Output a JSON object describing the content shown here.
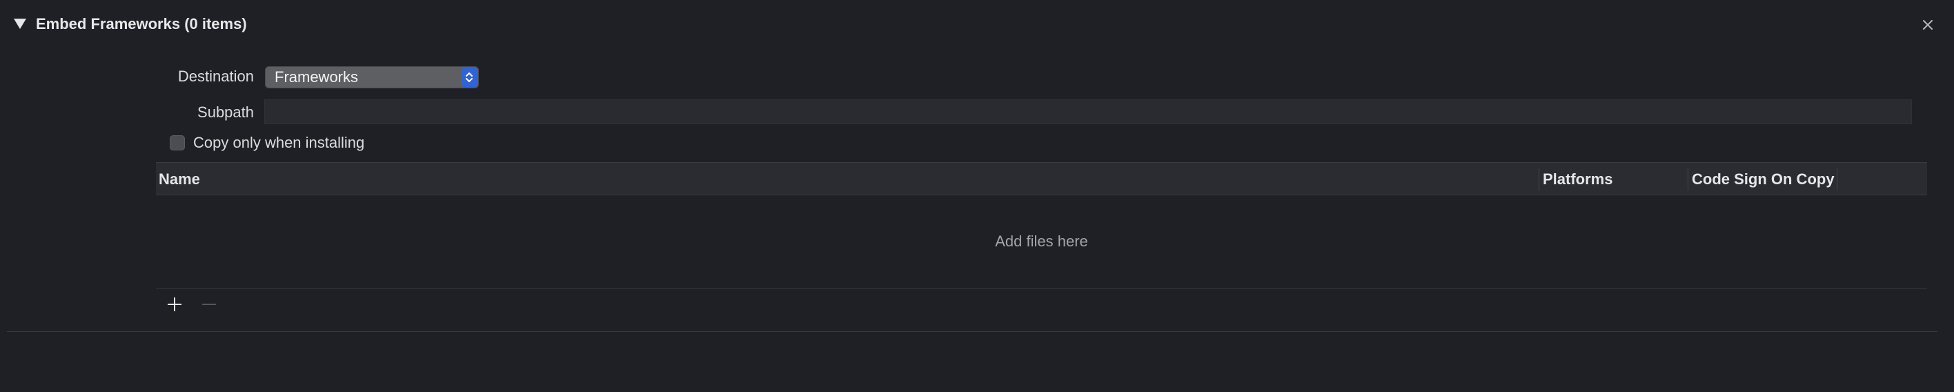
{
  "header": {
    "title": "Embed Frameworks (0 items)",
    "disclosure_icon": "disclosure-triangle-down-icon",
    "close_icon": "close-icon"
  },
  "form": {
    "destination_label": "Destination",
    "destination_value": "Frameworks",
    "subpath_label": "Subpath",
    "subpath_value": "",
    "copy_only_label": "Copy only when installing",
    "copy_only_checked": false
  },
  "table": {
    "columns": [
      "Name",
      "Platforms",
      "Code Sign On Copy"
    ],
    "rows": [],
    "empty_message": "Add files here"
  },
  "toolbar": {
    "add_icon": "plus-icon",
    "remove_icon": "minus-icon",
    "remove_enabled": false
  },
  "colors": {
    "background": "#1f2026",
    "accent": "#2f63d6",
    "header_bg": "#2b2c32"
  }
}
